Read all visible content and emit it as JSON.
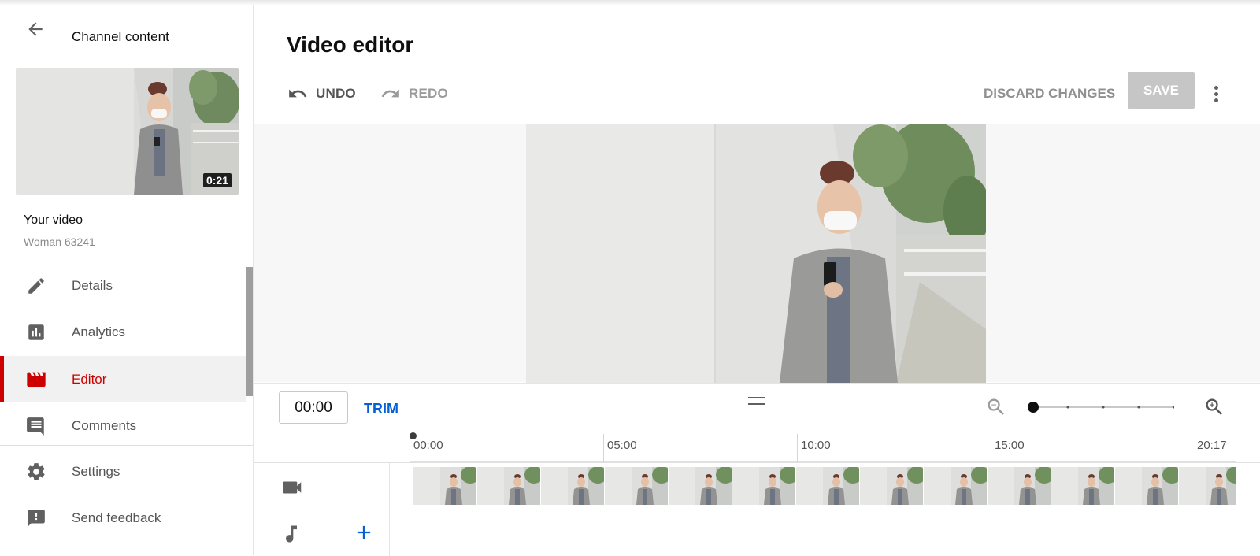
{
  "sidebar": {
    "header_title": "Channel content",
    "thumbnail_duration": "0:21",
    "your_video_label": "Your video",
    "video_name": "Woman 63241",
    "items": [
      {
        "label": "Details",
        "icon": "pencil-icon"
      },
      {
        "label": "Analytics",
        "icon": "bar-chart-icon"
      },
      {
        "label": "Editor",
        "icon": "clapperboard-icon",
        "active": true
      },
      {
        "label": "Comments",
        "icon": "comment-icon"
      }
    ],
    "footer_items": [
      {
        "label": "Settings",
        "icon": "gear-icon"
      },
      {
        "label": "Send feedback",
        "icon": "feedback-icon"
      }
    ]
  },
  "editor": {
    "title": "Video editor",
    "undo_label": "UNDO",
    "redo_label": "REDO",
    "discard_label": "DISCARD CHANGES",
    "save_label": "SAVE",
    "time_value": "00:00",
    "trim_label": "TRIM",
    "ruler_labels": [
      "00:00",
      "05:00",
      "10:00",
      "15:00",
      "20:17"
    ]
  },
  "colors": {
    "accent_red": "#cc0000",
    "link_blue": "#065fd4",
    "save_disabled": "#c6c6c6"
  }
}
